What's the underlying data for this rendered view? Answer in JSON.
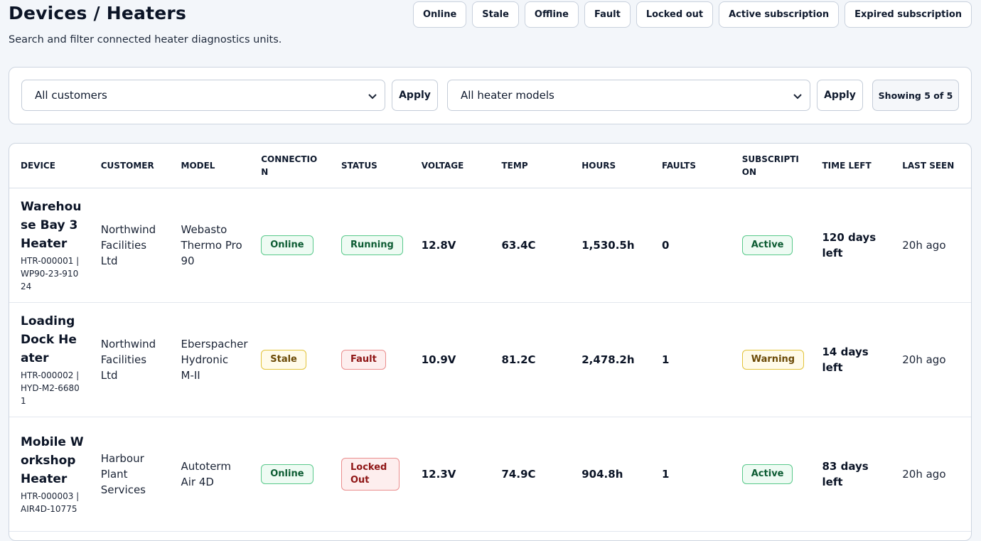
{
  "header": {
    "title": "Devices / Heaters",
    "subtitle": "Search and filter connected heater diagnostics units."
  },
  "legend": [
    "Online",
    "Stale",
    "Offline",
    "Fault",
    "Locked out",
    "Active subscription",
    "Expired subscription"
  ],
  "filters": {
    "customer_select": "All customers",
    "model_select": "All heater models",
    "apply_label": "Apply",
    "showing": "Showing 5 of 5"
  },
  "table": {
    "columns": [
      "DEVICE",
      "CUSTOMER",
      "MODEL",
      "CONNECTION",
      "STATUS",
      "VOLTAGE",
      "TEMP",
      "HOURS",
      "FAULTS",
      "SUBSCRIPTION",
      "TIME LEFT",
      "LAST SEEN"
    ],
    "rows": [
      {
        "name": "Warehouse Bay 3 Heater",
        "meta": "HTR-000001 | WP90-23-91024",
        "customer": "Northwind Facilities Ltd",
        "model": "Webasto Thermo Pro 90",
        "connection": "Online",
        "status": "Running",
        "voltage": "12.8V",
        "temp": "63.4C",
        "hours": "1,530.5h",
        "faults": "0",
        "subscription": "Active",
        "time_left": "120 days left",
        "last_seen": "20h ago"
      },
      {
        "name": "Loading Dock Heater",
        "meta": "HTR-000002 | HYD-M2-66801",
        "customer": "Northwind Facilities Ltd",
        "model": "Eberspacher Hydronic M-II",
        "connection": "Stale",
        "status": "Fault",
        "voltage": "10.9V",
        "temp": "81.2C",
        "hours": "2,478.2h",
        "faults": "1",
        "subscription": "Warning",
        "time_left": "14 days left",
        "last_seen": "20h ago"
      },
      {
        "name": "Mobile Workshop Heater",
        "meta": "HTR-000003 | AIR4D-10775",
        "customer": "Harbour Plant Services",
        "model": "Autoterm Air 4D",
        "connection": "Online",
        "status": "Locked Out",
        "voltage": "12.3V",
        "temp": "74.9C",
        "hours": "904.8h",
        "faults": "1",
        "subscription": "Active",
        "time_left": "83 days left",
        "last_seen": "20h ago"
      }
    ]
  },
  "colors": {
    "ok": "#59c98b",
    "warn": "#e2c33a",
    "bad": "#ea8d8d"
  }
}
